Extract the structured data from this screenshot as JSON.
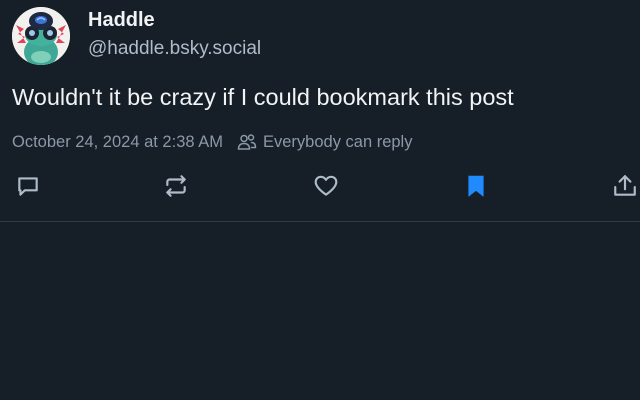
{
  "author": {
    "display_name": "Haddle",
    "handle": "@haddle.bsky.social",
    "avatar_icon": "frog-avatar-with-goggles"
  },
  "post": {
    "text": "Wouldn't it be crazy if I could bookmark this post",
    "timestamp": "October 24, 2024 at 2:38 AM",
    "reply_setting": "Everybody can reply"
  },
  "actions": {
    "reply_icon": "comment-icon",
    "repost_icon": "repost-icon",
    "like_icon": "heart-icon",
    "bookmark_icon": "bookmark-icon",
    "share_icon": "share-icon",
    "bookmark_active": true
  },
  "colors": {
    "background": "#161e27",
    "text": "#f1f3f5",
    "muted": "#8b98a8",
    "icon": "#aebbc9",
    "accent": "#208bfe",
    "divider": "#2e3a47"
  }
}
